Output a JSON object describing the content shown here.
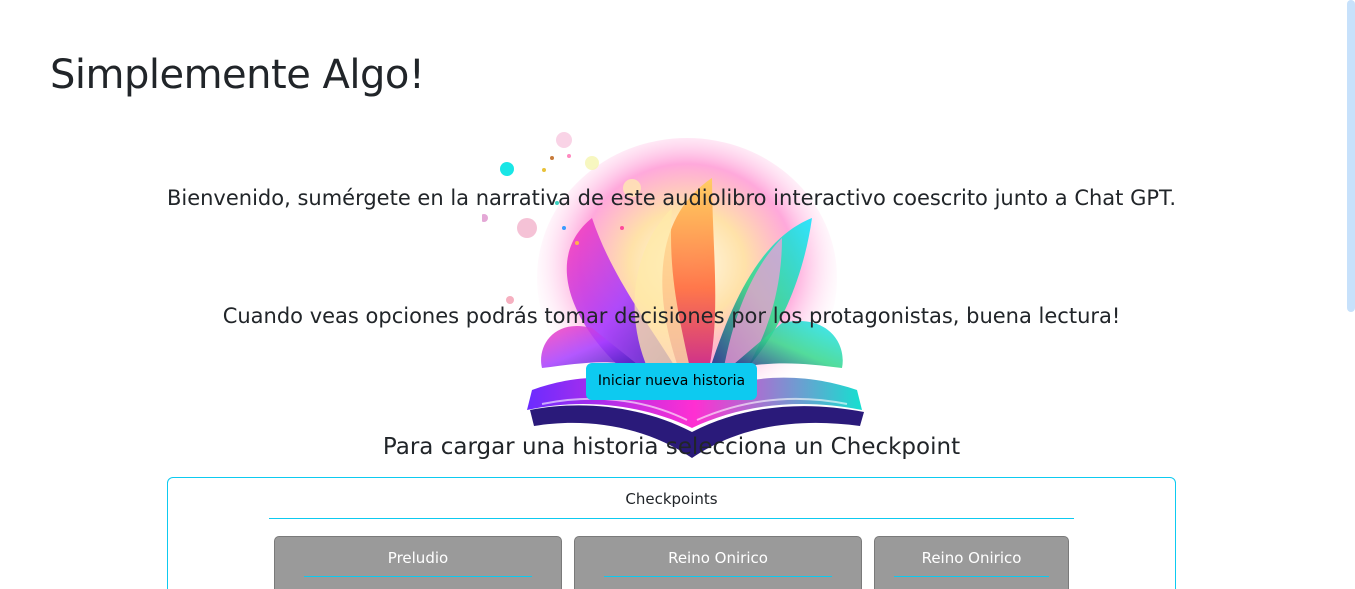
{
  "header": {
    "title": "Simplemente Algo!"
  },
  "intro": {
    "welcome": "Bienvenido, sumérgete en la narrativa de este audiolibro interactivo coescrito junto a Chat GPT.",
    "options_hint": "Cuando veas opciones podrás tomar decisiones por los protagonistas, buena lectura!"
  },
  "actions": {
    "start_label": "Iniciar nueva historia"
  },
  "load": {
    "heading": "Para cargar una historia selecciona un Checkpoint"
  },
  "checkpoints": {
    "title": "Checkpoints",
    "items": [
      {
        "label": "Preludio"
      },
      {
        "label": "Reino Onirico"
      },
      {
        "label": "Reino Onirico"
      }
    ]
  },
  "colors": {
    "accent": "#0dcaf0",
    "card_bg": "#9a9a9a",
    "text": "#212529"
  },
  "icons": {
    "hero": "magic-book-icon"
  }
}
